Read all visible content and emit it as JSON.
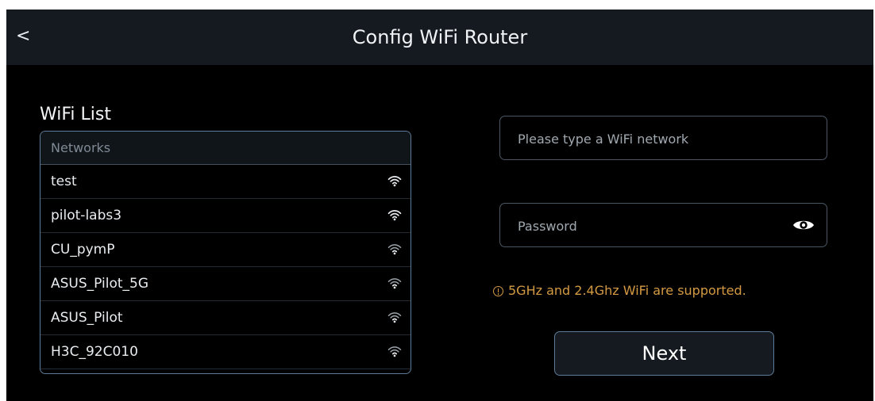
{
  "header": {
    "back_label": "<",
    "title": "Config WiFi Router"
  },
  "wifi_list": {
    "title": "WiFi List",
    "column_header": "Networks",
    "networks": [
      {
        "name": "test",
        "icon": "wifi-icon"
      },
      {
        "name": "pilot-labs3",
        "icon": "wifi-icon"
      },
      {
        "name": "CU_pymP",
        "icon": "wifi-icon"
      },
      {
        "name": "ASUS_Pilot_5G",
        "icon": "wifi-icon"
      },
      {
        "name": "ASUS_Pilot",
        "icon": "wifi-icon"
      },
      {
        "name": "H3C_92C010",
        "icon": "wifi-icon"
      }
    ]
  },
  "form": {
    "ssid": {
      "value": "",
      "placeholder": "Please type a WiFi network"
    },
    "password": {
      "value": "",
      "placeholder": "Password",
      "toggle_icon": "eye-icon"
    },
    "notice": "5GHz and 2.4Ghz WiFi are supported.",
    "next_label": "Next"
  },
  "colors": {
    "background": "#000000",
    "header": "#141a1f",
    "accent_border": "#5d7b97",
    "warning": "#d49a43",
    "text": "#e9edf0"
  }
}
